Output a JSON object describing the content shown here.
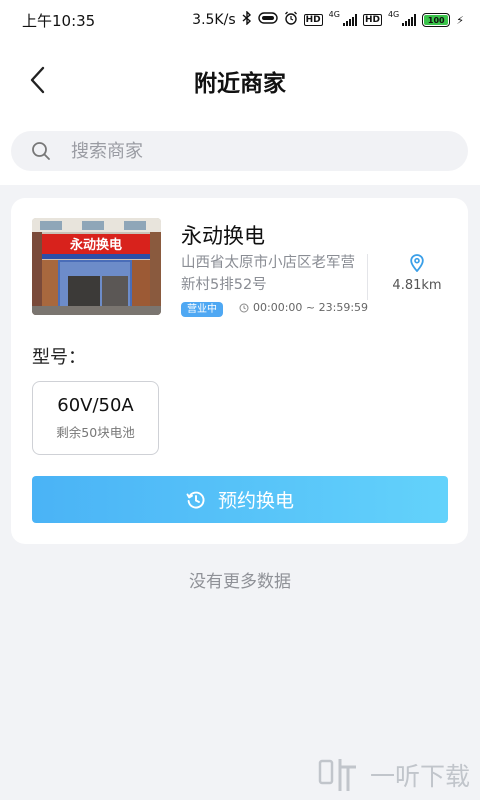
{
  "statusbar": {
    "time": "上午10:35",
    "network_speed": "3.5K/s",
    "hd1": "HD",
    "net1": "4G",
    "hd2": "HD",
    "net2": "4G",
    "battery": "100"
  },
  "header": {
    "title": "附近商家",
    "back_icon": "back-arrow-icon"
  },
  "search": {
    "placeholder": "搜索商家",
    "value": ""
  },
  "store": {
    "image_sign_text": "永动换电",
    "name": "永动换电",
    "address": "山西省太原市小店区老军营新村5排52号",
    "distance": "4.81km",
    "status": "营业中",
    "hours": "00:00:00 ~ 23:59:59"
  },
  "model": {
    "label": "型号：",
    "spec": "60V/50A",
    "remaining": "剩余50块电池"
  },
  "book_button": {
    "label": "预约换电"
  },
  "list_footer": {
    "text": "没有更多数据"
  },
  "watermark": {
    "text": "一听下载"
  },
  "colors": {
    "accent": "#4ab3f6",
    "accent_end": "#63d2fb",
    "status_badge": "#4fa8f3",
    "background": "#f2f3f6"
  }
}
